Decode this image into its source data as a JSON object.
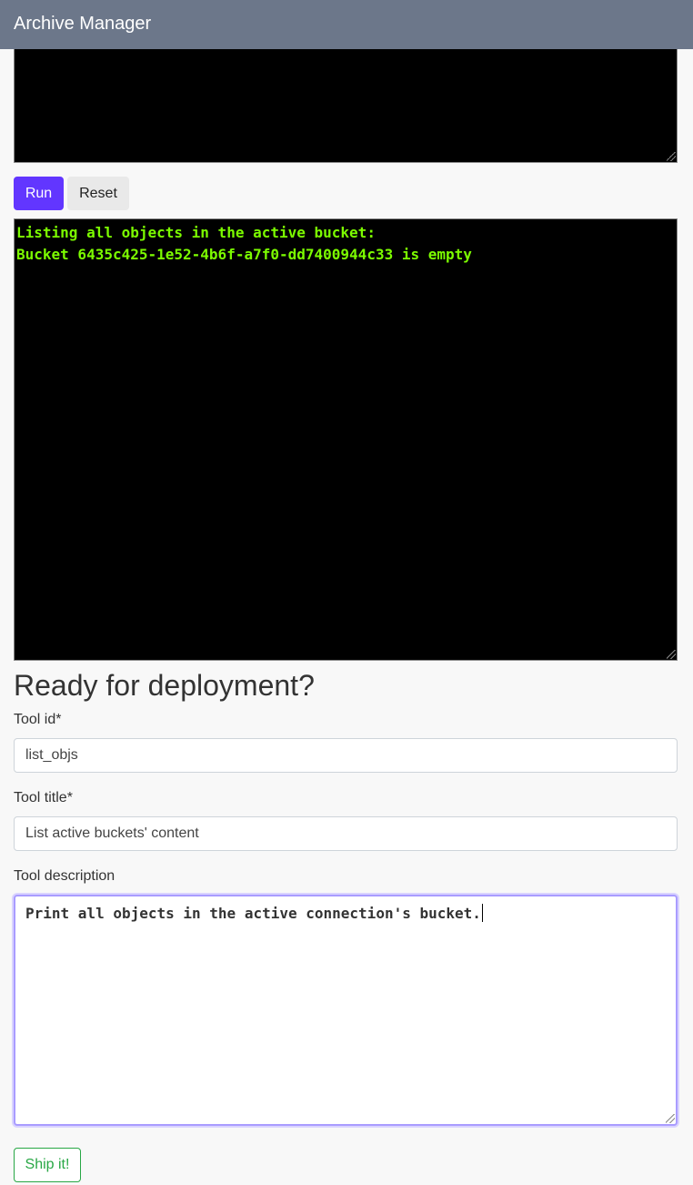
{
  "header": {
    "title": "Archive Manager"
  },
  "editor": {
    "run_label": "Run",
    "reset_label": "Reset"
  },
  "output": {
    "lines": [
      "Listing all objects in the active bucket:",
      "Bucket 6435c425-1e52-4b6f-a7f0-dd7400944c33 is empty"
    ]
  },
  "deploy": {
    "heading": "Ready for deployment?",
    "tool_id_label": "Tool id*",
    "tool_id_value": "list_objs",
    "tool_title_label": "Tool title*",
    "tool_title_value": "List active buckets' content",
    "tool_description_label": "Tool description",
    "tool_description_value": "Print all objects in the active connection's bucket.",
    "ship_label": "Ship it!"
  },
  "colors": {
    "header_bg": "#6c778a",
    "run_button": "#6236ff",
    "terminal_text": "#7cfc00",
    "ship_button": "#28a745"
  }
}
